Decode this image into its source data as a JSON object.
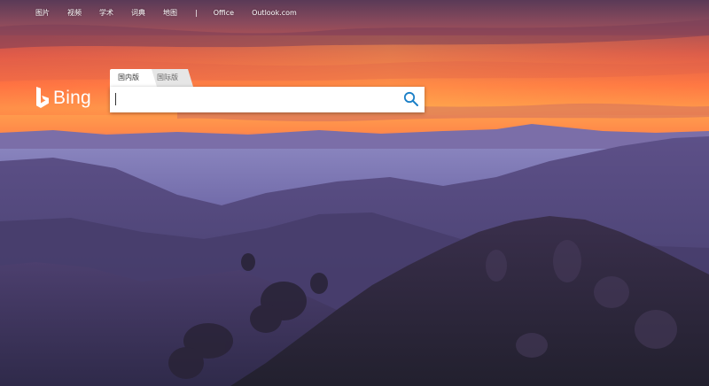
{
  "nav": {
    "items": [
      "图片",
      "视频",
      "学术",
      "词典",
      "地图"
    ],
    "separator": "|",
    "extra_items": [
      "Office",
      "Outlook.com"
    ]
  },
  "logo": {
    "text": "Bing"
  },
  "search": {
    "tabs": [
      {
        "label": "国内版",
        "active": true
      },
      {
        "label": "国际版",
        "active": false
      }
    ],
    "value": "",
    "placeholder": ""
  },
  "colors": {
    "accent": "#1a7fc7",
    "sky_top": "#5c3a5a",
    "sky_glow": "#ff8a3c",
    "mountain": "#4a3f66"
  },
  "icons": {
    "logo": "bing-b-icon",
    "search": "magnifier-icon"
  }
}
